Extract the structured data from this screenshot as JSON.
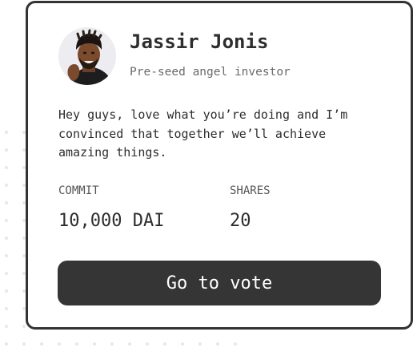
{
  "investor": {
    "name": "Jassir Jonis",
    "role": "Pre-seed angel investor",
    "message": "Hey guys, love what you’re doing and I’m convinced that together we’ll achieve amazing things."
  },
  "stats": {
    "commit_label": "COMMIT",
    "commit_value": "10,000 DAI",
    "shares_label": "SHARES",
    "shares_value": "20"
  },
  "actions": {
    "vote_label": "Go to vote"
  },
  "colors": {
    "card_border": "#333333",
    "button_bg": "#353535",
    "button_text": "#ffffff",
    "avatar_bg": "#ededf1"
  }
}
